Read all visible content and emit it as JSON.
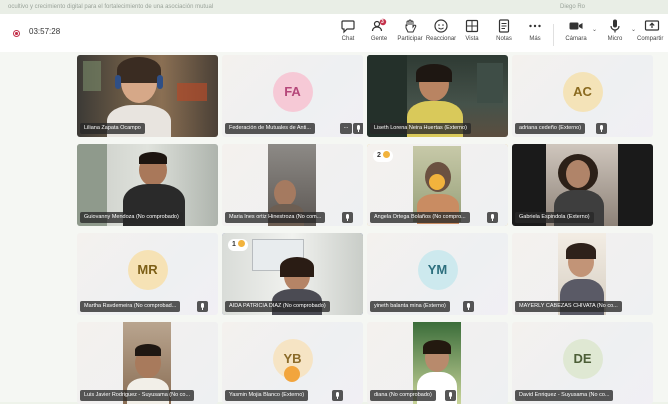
{
  "window": {
    "title": "ocultivo y crecimiento digital para el fortalecimiento de una asociación mutual",
    "right_text": "Diego Ro"
  },
  "toolbar": {
    "timer": "03:57:28",
    "buttons": [
      {
        "label": "Chat",
        "icon": "chat-icon"
      },
      {
        "label": "Gente",
        "icon": "people-icon",
        "badge": "3"
      },
      {
        "label": "Participar",
        "icon": "raise-hand-icon"
      },
      {
        "label": "Reaccionar",
        "icon": "smiley-icon"
      },
      {
        "label": "Vista",
        "icon": "view-grid-icon"
      },
      {
        "label": "Notas",
        "icon": "notes-icon"
      },
      {
        "label": "Más",
        "icon": "more-icon"
      },
      {
        "label": "Cámara",
        "icon": "camera-icon"
      },
      {
        "label": "Micro",
        "icon": "microphone-icon"
      },
      {
        "label": "Compartir",
        "icon": "share-icon"
      }
    ]
  },
  "participants": [
    {
      "name": "Liliana Zapata Ocampo",
      "type": "video"
    },
    {
      "name": "Federación de Mutuales de Anti...",
      "type": "avatar",
      "initials": "FA",
      "color": "#f6c9d6",
      "text_color": "#b5477a"
    },
    {
      "name": "Liseth Lorena Neira Huertas (Externo)",
      "type": "video"
    },
    {
      "name": "adriana cedeño (Externo)",
      "type": "avatar",
      "initials": "AC",
      "color": "#f4e3b8",
      "text_color": "#8a6a1f"
    },
    {
      "name": "Guiovanny Mendoza (No comprobado)",
      "type": "video"
    },
    {
      "name": "Maria Ines ortiz Hinestroza (No com...",
      "type": "video"
    },
    {
      "name": "Angela Ortega Bolaños (No compro...",
      "type": "video",
      "hand": "2"
    },
    {
      "name": "Gabriela Espindola (Externo)",
      "type": "video"
    },
    {
      "name": "Martha Ravdemeira (No comprobad...",
      "type": "avatar",
      "initials": "MR",
      "color": "#f6e2b5",
      "text_color": "#7d5f16"
    },
    {
      "name": "AIDA PATRICIA DIAZ (No comprobado)",
      "type": "video",
      "hand": "1"
    },
    {
      "name": "yineth balanta mina (Externo)",
      "type": "avatar",
      "initials": "YM",
      "color": "#cde9ee",
      "text_color": "#2c6f7e"
    },
    {
      "name": "MAYERLY CABEZAS CHIVATA (No co...",
      "type": "video"
    },
    {
      "name": "Luis Javier Rodriguez - Suyusama (No co...",
      "type": "video"
    },
    {
      "name": "Yasmin Mojia Blanco (Externo)",
      "type": "avatar",
      "initials": "YB",
      "color": "#f6e4c4",
      "text_color": "#8b6a28"
    },
    {
      "name": "diana (No comprobado)",
      "type": "video"
    },
    {
      "name": "David Enriquez - Suyusama (No co...",
      "type": "avatar",
      "initials": "DE",
      "color": "#dfe8d3",
      "text_color": "#4c5e37"
    }
  ],
  "colors": {
    "accent": "#6264a7",
    "recording": "#c4314b",
    "raised_hand": "#f2b33d",
    "active_speaker": "#e8b84a"
  }
}
